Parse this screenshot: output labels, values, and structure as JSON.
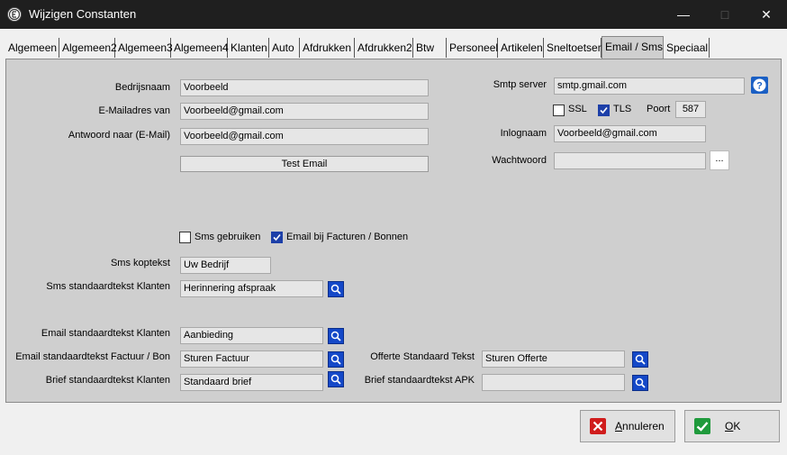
{
  "window": {
    "title": "Wijzigen Constanten",
    "minimize_icon": "minimize-icon",
    "maximize_icon": "maximize-icon",
    "close_icon": "close-icon"
  },
  "tabs": [
    {
      "label": "Algemeen"
    },
    {
      "label": "Algemeen2"
    },
    {
      "label": "Algemeen3"
    },
    {
      "label": "Algemeen4"
    },
    {
      "label": "Klanten"
    },
    {
      "label": "Auto"
    },
    {
      "label": "Afdrukken"
    },
    {
      "label": "Afdrukken2"
    },
    {
      "label": "Btw"
    },
    {
      "label": "Personeel"
    },
    {
      "label": "Artikelen"
    },
    {
      "label": "Sneltoetsen"
    },
    {
      "label": "Email / Sms"
    },
    {
      "label": "Speciaal"
    }
  ],
  "active_tab": "Email / Sms",
  "email": {
    "bedrijfsnaam_label": "Bedrijsnaam",
    "bedrijfsnaam_value": "Voorbeeld",
    "emailadres_label": "E-Mailadres van",
    "emailadres_value": "Voorbeeld@gmail.com",
    "antwoord_label": "Antwoord naar (E-Mail)",
    "antwoord_value": "Voorbeeld@gmail.com",
    "test_button": "Test Email"
  },
  "smtp": {
    "server_label": "Smtp server",
    "server_value": "smtp.gmail.com",
    "ssl_label": "SSL",
    "ssl_checked": false,
    "tls_label": "TLS",
    "tls_checked": true,
    "poort_label": "Poort",
    "poort_value": "587",
    "inlognaam_label": "Inlognaam",
    "inlognaam_value": "Voorbeeld@gmail.com",
    "wachtwoord_label": "Wachtwoord",
    "wachtwoord_value": "",
    "dots_button": "..."
  },
  "sms": {
    "gebruiken_label": "Sms gebruiken",
    "gebruiken_checked": false,
    "email_facturen_label": "Email bij Facturen / Bonnen",
    "email_facturen_checked": true,
    "koptekst_label": "Sms koptekst",
    "koptekst_value": "Uw Bedrijf",
    "standaard_label": "Sms standaardtekst Klanten",
    "standaard_value": "Herinnering afspraak"
  },
  "templates": {
    "email_klanten_label": "Email standaardtekst Klanten",
    "email_klanten_value": "Aanbieding",
    "email_factuur_label": "Email standaardtekst Factuur / Bon",
    "email_factuur_value": "Sturen Factuur",
    "brief_klanten_label": "Brief standaardtekst Klanten",
    "brief_klanten_value": "Standaard brief",
    "offerte_label": "Offerte Standaard Tekst",
    "offerte_value": "Sturen Offerte",
    "brief_apk_label": "Brief standaardtekst APK",
    "brief_apk_value": ""
  },
  "footer": {
    "cancel_prefix": "A",
    "cancel_rest": "nnuleren",
    "ok_prefix": "O",
    "ok_rest": "K"
  },
  "colors": {
    "accent_blue": "#1448c8",
    "cancel_red": "#d01c1c",
    "ok_green": "#1f9a3c"
  }
}
